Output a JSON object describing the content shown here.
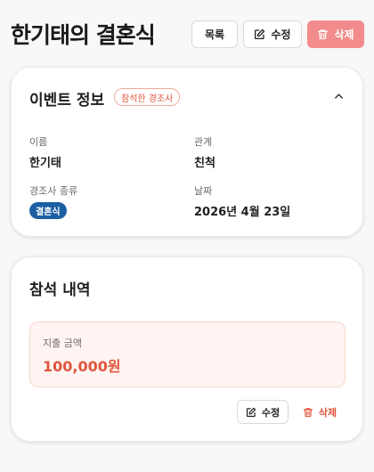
{
  "page": {
    "title": "한기태의 결혼식"
  },
  "toolbar": {
    "list_label": "목록",
    "edit_label": "수정",
    "delete_label": "삭제"
  },
  "event_card": {
    "title": "이벤트 정보",
    "status_badge": "참석한 경조사",
    "fields": {
      "name": {
        "label": "이름",
        "value": "한기태"
      },
      "relation": {
        "label": "관계",
        "value": "친척"
      },
      "type": {
        "label": "경조사 종류",
        "value": "결혼식"
      },
      "date": {
        "label": "날짜",
        "value": "2026년 4월 23일"
      }
    }
  },
  "attendance_card": {
    "title": "참석 내역",
    "amount_label": "지출 금액",
    "amount_value": "100,000원",
    "edit_label": "수정",
    "delete_label": "삭제"
  },
  "colors": {
    "accent": "#e0553c",
    "danger_button": "#f28b8b",
    "type_pill": "#1d5fa3",
    "amount_bg": "#fff4f1"
  },
  "icons": [
    "edit-icon",
    "trash-icon",
    "chevron-up-icon"
  ]
}
